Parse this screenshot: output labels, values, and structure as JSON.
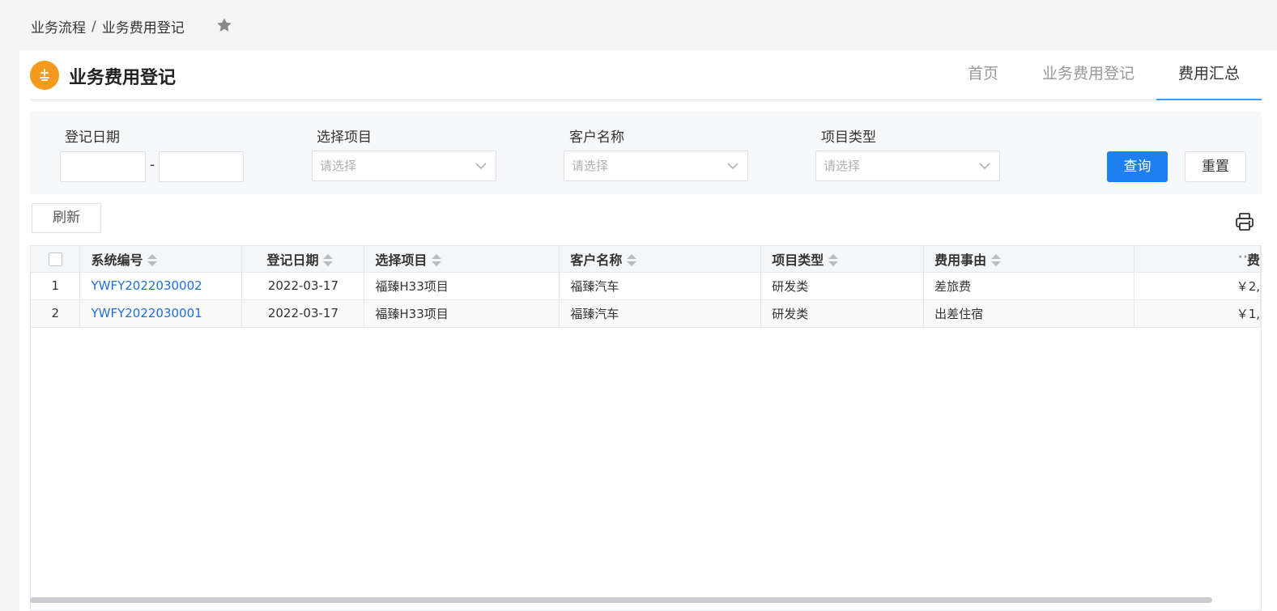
{
  "breadcrumb": {
    "parent": "业务流程",
    "separator": "/",
    "current": "业务费用登记"
  },
  "header": {
    "title": "业务费用登记"
  },
  "tabs": [
    {
      "label": "首页",
      "active": false
    },
    {
      "label": "业务费用登记",
      "active": false
    },
    {
      "label": "费用汇总",
      "active": true
    }
  ],
  "filters": {
    "date_label": "登记日期",
    "date_separator": "-",
    "project_label": "选择项目",
    "project_placeholder": "请选择",
    "customer_label": "客户名称",
    "customer_placeholder": "请选择",
    "type_label": "项目类型",
    "type_placeholder": "请选择",
    "query_label": "查询",
    "reset_label": "重置"
  },
  "toolbar": {
    "refresh_label": "刷新"
  },
  "table": {
    "columns": [
      "系统编号",
      "登记日期",
      "选择项目",
      "客户名称",
      "项目类型",
      "费用事由",
      "费"
    ],
    "rows": [
      {
        "index": "1",
        "code": "YWFY2022030002",
        "date": "2022-03-17",
        "project": "福臻H33项目",
        "customer": "福臻汽车",
        "type": "研发类",
        "reason": "差旅费",
        "amount": "￥2,"
      },
      {
        "index": "2",
        "code": "YWFY2022030001",
        "date": "2022-03-17",
        "project": "福臻H33项目",
        "customer": "福臻汽车",
        "type": "研发类",
        "reason": "出差住宿",
        "amount": "￥1,"
      }
    ]
  },
  "colors": {
    "primary": "#1e7ff0",
    "brand": "#f39a1f",
    "link": "#1e6fd9"
  }
}
